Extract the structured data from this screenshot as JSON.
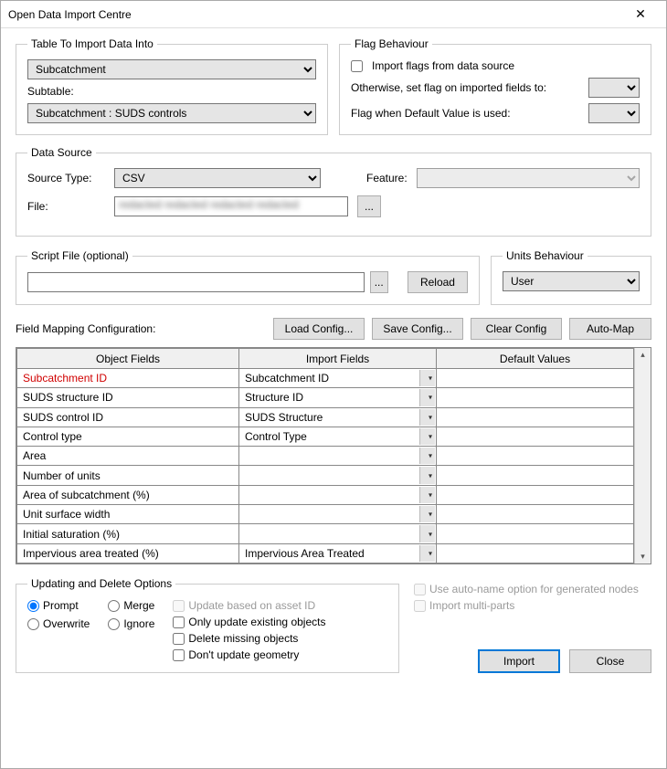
{
  "window": {
    "title": "Open Data Import Centre"
  },
  "table_import": {
    "legend": "Table To Import Data Into",
    "table_value": "Subcatchment",
    "subtable_label": "Subtable:",
    "subtable_value": "Subcatchment : SUDS controls"
  },
  "flag_behaviour": {
    "legend": "Flag Behaviour",
    "import_flags_label": "Import flags from data source",
    "otherwise_label": "Otherwise, set flag on imported fields to:",
    "flag_default_label": "Flag when Default Value is used:"
  },
  "data_source": {
    "legend": "Data Source",
    "source_type_label": "Source Type:",
    "source_type_value": "CSV",
    "feature_label": "Feature:",
    "file_label": "File:",
    "file_value": "redacted redacted redacted  redacted"
  },
  "script_file": {
    "legend": "Script File (optional)",
    "reload_label": "Reload"
  },
  "units_behaviour": {
    "legend": "Units Behaviour",
    "value": "User"
  },
  "field_mapping": {
    "label": "Field Mapping Configuration:",
    "buttons": {
      "load": "Load Config...",
      "save": "Save Config...",
      "clear": "Clear Config",
      "automap": "Auto-Map"
    },
    "headers": {
      "object": "Object Fields",
      "import": "Import Fields",
      "default": "Default Values"
    },
    "rows": [
      {
        "object": "Subcatchment ID",
        "import": "Subcatchment ID",
        "default": "",
        "required": true
      },
      {
        "object": "SUDS structure ID",
        "import": "Structure ID",
        "default": "",
        "required": false
      },
      {
        "object": "SUDS control ID",
        "import": "SUDS Structure",
        "default": "",
        "required": false
      },
      {
        "object": "Control type",
        "import": "Control Type",
        "default": "",
        "required": false
      },
      {
        "object": "Area",
        "import": "",
        "default": "",
        "required": false
      },
      {
        "object": "Number of units",
        "import": "",
        "default": "",
        "required": false
      },
      {
        "object": "Area of subcatchment (%)",
        "import": "",
        "default": "",
        "required": false
      },
      {
        "object": "Unit surface width",
        "import": "",
        "default": "",
        "required": false
      },
      {
        "object": "Initial saturation (%)",
        "import": "",
        "default": "",
        "required": false
      },
      {
        "object": "Impervious area treated (%)",
        "import": "Impervious Area Treated",
        "default": "",
        "required": false
      }
    ]
  },
  "updating_options": {
    "legend": "Updating and Delete Options",
    "radios": {
      "prompt": "Prompt",
      "merge": "Merge",
      "overwrite": "Overwrite",
      "ignore": "Ignore"
    },
    "checks": {
      "update_asset_id": "Update based on asset ID",
      "only_existing": "Only update existing objects",
      "delete_missing": "Delete missing objects",
      "dont_update_geom": "Don't update geometry"
    }
  },
  "right_checks": {
    "auto_name": "Use auto-name option for generated nodes",
    "multi_parts": "Import multi-parts"
  },
  "final_buttons": {
    "import": "Import",
    "close": "Close"
  }
}
